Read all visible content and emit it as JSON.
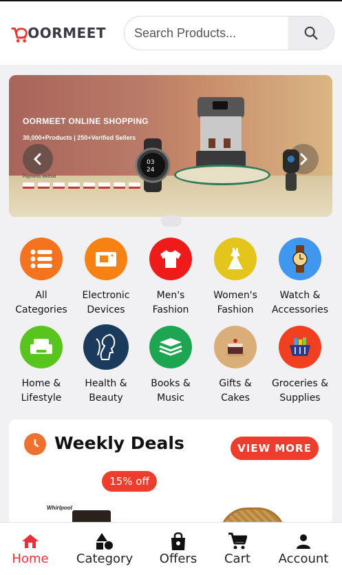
{
  "header": {
    "logo_text": "OORMEET",
    "search": {
      "placeholder": "Search Products..."
    }
  },
  "banner": {
    "title": "OORMEET ONLINE SHOPPING",
    "subtitle": "30,000+Products  |  250+Verified Sellers",
    "payments_label": "Payments Method"
  },
  "categories": [
    {
      "line1": "All",
      "line2": "Categories",
      "icon": "list-icon",
      "color": "#f5731f"
    },
    {
      "line1": "Electronic",
      "line2": "Devices",
      "icon": "camera-icon",
      "color": "#f58213"
    },
    {
      "line1": "Men's",
      "line2": "Fashion",
      "icon": "tshirt-icon",
      "color": "#ef1b1b"
    },
    {
      "line1": "Women's",
      "line2": "Fashion",
      "icon": "dress-icon",
      "color": "#e3c51c"
    },
    {
      "line1": "Watch &",
      "line2": "Accessories",
      "icon": "watch-icon",
      "color": "#3f97f0"
    },
    {
      "line1": "Home &",
      "line2": "Lifestyle",
      "icon": "sofa-icon",
      "color": "#58c51f"
    },
    {
      "line1": "Health &",
      "line2": "Beauty",
      "icon": "face-icon",
      "color": "#1b3b5c"
    },
    {
      "line1": "Books &",
      "line2": "Music",
      "icon": "books-icon",
      "color": "#1ea552"
    },
    {
      "line1": "Gifts &",
      "line2": "Cakes",
      "icon": "cake-icon",
      "color": "#d9ae78"
    },
    {
      "line1": "Groceries &",
      "line2": "Supplies",
      "icon": "basket-icon",
      "color": "#f0401f"
    }
  ],
  "deals": {
    "title": "Weekly Deals",
    "view_more": "VIEW MORE",
    "badge": "15% off",
    "product_brand": "Whirlpool"
  },
  "nav": [
    {
      "label": "Home",
      "icon": "home-icon",
      "active": true
    },
    {
      "label": "Category",
      "icon": "shapes-icon",
      "active": false
    },
    {
      "label": "Offers",
      "icon": "shopping-bag-icon",
      "active": false
    },
    {
      "label": "Cart",
      "icon": "cart-icon",
      "active": false
    },
    {
      "label": "Account",
      "icon": "person-icon",
      "active": false
    }
  ],
  "colors": {
    "accent": "#ee3d2c",
    "active_nav": "#e8303c",
    "logo_red": "#e53935"
  }
}
